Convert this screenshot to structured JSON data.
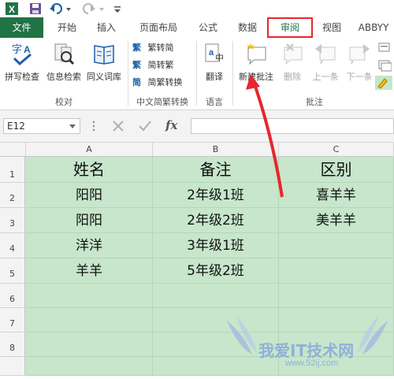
{
  "ribbon_tabs": [
    "文件",
    "开始",
    "插入",
    "页面布局",
    "公式",
    "数据",
    "审阅",
    "视图",
    "ABBYY"
  ],
  "active_tab": "审阅",
  "groups": {
    "proofing": {
      "label": "校对",
      "buttons": [
        "拼写检查",
        "信息检索",
        "同义词库"
      ]
    },
    "chinese": {
      "label": "中文简繁转换",
      "buttons": [
        "繁转简",
        "简转繁",
        "简繁转换"
      ]
    },
    "language": {
      "label": "语言",
      "buttons": [
        "翻译"
      ]
    },
    "comments": {
      "label": "批注",
      "buttons": [
        "新建批注",
        "删除",
        "上一条",
        "下一条"
      ]
    }
  },
  "name_box": "E12",
  "fx_label": "fx",
  "columns": [
    "A",
    "B",
    "C"
  ],
  "rows": [
    "1",
    "2",
    "3",
    "4",
    "5",
    "6",
    "7",
    "8"
  ],
  "cells": [
    [
      "姓名",
      "备注",
      "区别"
    ],
    [
      "阳阳",
      "2年级1班",
      "喜羊羊"
    ],
    [
      "阳阳",
      "2年级2班",
      "美羊羊"
    ],
    [
      "洋洋",
      "3年级1班",
      ""
    ],
    [
      "羊羊",
      "5年级2班",
      ""
    ],
    [
      "",
      "",
      ""
    ],
    [
      "",
      "",
      ""
    ],
    [
      "",
      "",
      ""
    ]
  ],
  "watermark": {
    "text": "我爱IT技术网",
    "url": "www.52ij.com"
  },
  "colors": {
    "accent": "#217346",
    "highlight": "#e8262d",
    "cell_fill": "#c7e6cb"
  }
}
